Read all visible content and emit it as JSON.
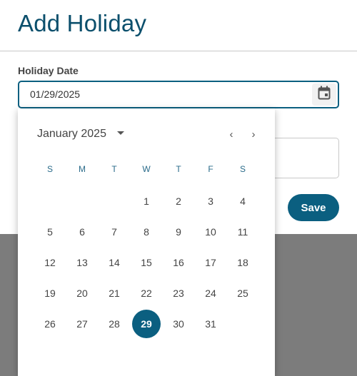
{
  "dialog": {
    "title": "Add Holiday",
    "date_label": "Holiday Date",
    "date_value": "01/29/2025",
    "save_label": "Save"
  },
  "picker": {
    "month_label": "January 2025",
    "prev_glyph": "‹",
    "next_glyph": "›",
    "weekdays": [
      "S",
      "M",
      "T",
      "W",
      "T",
      "F",
      "S"
    ],
    "first_weekday_index": 3,
    "days": [
      "1",
      "2",
      "3",
      "4",
      "5",
      "6",
      "7",
      "8",
      "9",
      "10",
      "11",
      "12",
      "13",
      "14",
      "15",
      "16",
      "17",
      "18",
      "19",
      "20",
      "21",
      "22",
      "23",
      "24",
      "25",
      "26",
      "27",
      "28",
      "29",
      "30",
      "31"
    ],
    "selected_day": "29"
  },
  "icons": {
    "calendar": "calendar-icon",
    "dropdown": "chevron-down-icon",
    "prev": "chevron-left-icon",
    "next": "chevron-right-icon"
  },
  "colors": {
    "accent": "#0b5f80",
    "title": "#0b4f6c",
    "backdrop": "#7c7c7c"
  }
}
